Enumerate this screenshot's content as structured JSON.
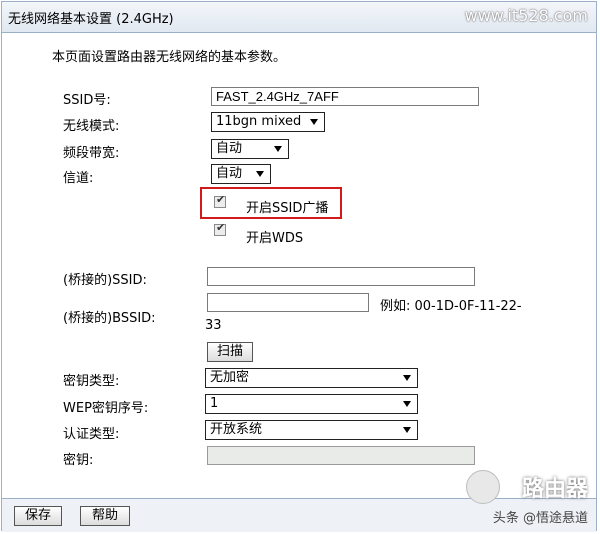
{
  "page": {
    "title": "无线网络基本设置 (2.4GHz)",
    "watermark": "www.it528.com",
    "description": "本页面设置路由器无线网络的基本参数。"
  },
  "form": {
    "ssid_label": "SSID号:",
    "ssid_value": "FAST_2.4GHz_7AFF",
    "mode_label": "无线模式:",
    "mode_value": "11bgn mixed",
    "bandwidth_label": "频段带宽:",
    "bandwidth_value": "自动",
    "channel_label": "信道:",
    "channel_value": "自动",
    "ssid_broadcast_label": "开启SSID广播",
    "ssid_broadcast_checked": true,
    "wds_label": "开启WDS",
    "wds_checked": true,
    "bridged_ssid_label": "(桥接的)SSID:",
    "bridged_ssid_value": "",
    "bridged_bssid_label": "(桥接的)BSSID:",
    "bridged_bssid_value": "",
    "bssid_example_line1": "例如: 00-1D-0F-11-22-",
    "bssid_example_line2": "33",
    "scan_button": "扫描",
    "key_type_label": "密钥类型:",
    "key_type_value": "无加密",
    "wep_index_label": "WEP密钥序号:",
    "wep_index_value": "1",
    "auth_type_label": "认证类型:",
    "auth_type_value": "开放系统",
    "key_label": "密钥:",
    "key_value": ""
  },
  "footer": {
    "save_button": "保存",
    "help_button": "帮助",
    "brand_logo": "路由器",
    "source_text": "头条 @悟途悬道"
  },
  "colors": {
    "highlight": "#d21a1a",
    "title_bar": "#e1e8f1",
    "border": "#9ab0c8"
  }
}
